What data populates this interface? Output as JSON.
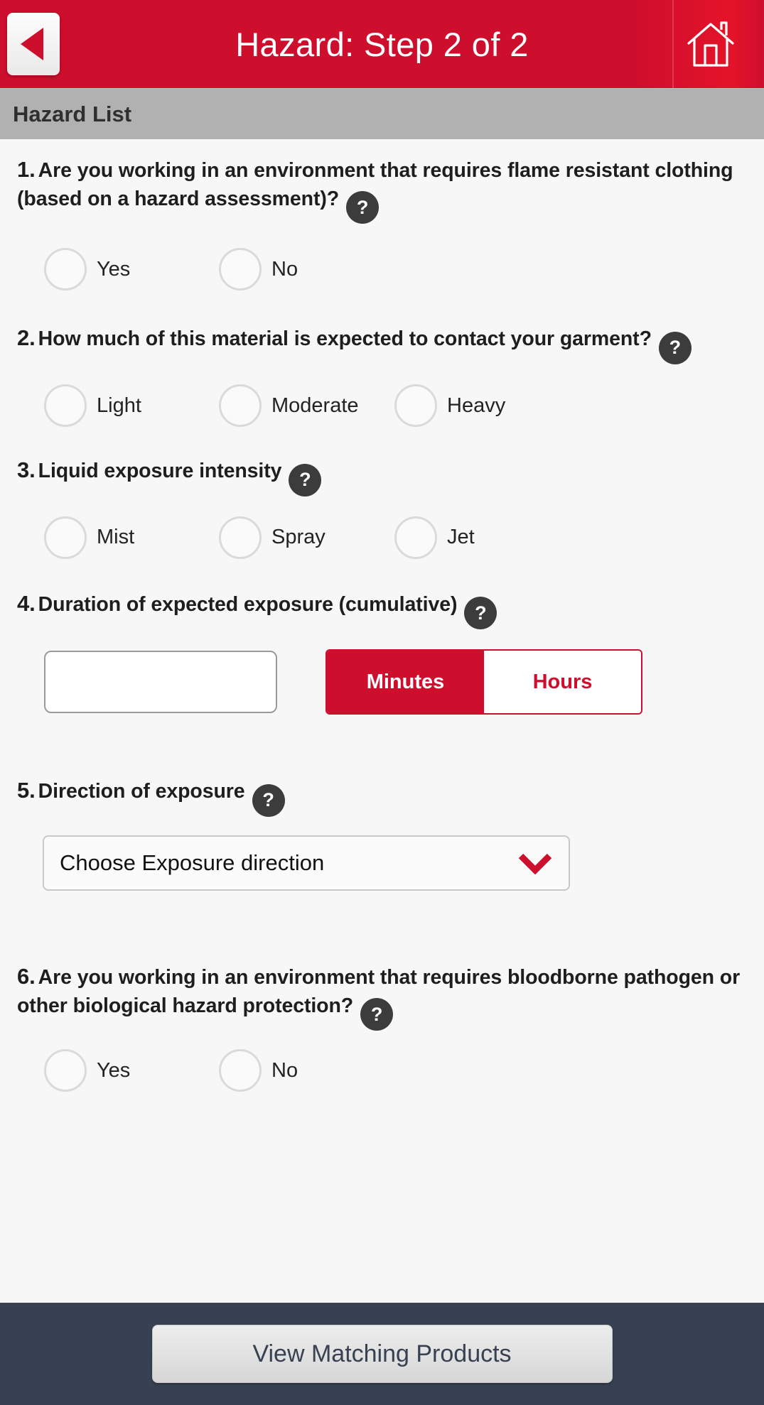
{
  "header": {
    "title": "Hazard: Step 2 of 2",
    "back_icon": "back-triangle-icon",
    "home_icon": "home-icon",
    "accent_color": "#CE0E2D"
  },
  "section": {
    "title": "Hazard List",
    "background_color": "#B1B1B1"
  },
  "help_glyph": "?",
  "questions": [
    {
      "number": "1.",
      "text": "Are you working in an environment that requires flame resistant clothing (based on a hazard assessment)?",
      "type": "radio",
      "options": [
        "Yes",
        "No"
      ]
    },
    {
      "number": "2.",
      "text": "How much of this material is expected to contact your garment?",
      "type": "radio",
      "options": [
        "Light",
        "Moderate",
        "Heavy"
      ]
    },
    {
      "number": "3.",
      "text": "Liquid exposure intensity",
      "type": "radio",
      "options": [
        "Mist",
        "Spray",
        "Jet"
      ]
    },
    {
      "number": "4.",
      "text": "Duration of expected exposure (cumulative)",
      "type": "duration",
      "input_value": "",
      "input_placeholder": "",
      "units": [
        "Minutes",
        "Hours"
      ],
      "selected_unit": "Minutes"
    },
    {
      "number": "5.",
      "text": "Direction of exposure",
      "type": "select",
      "selected_value": "Choose Exposure direction",
      "chevron_icon": "chevron-down-icon",
      "chevron_color": "#CE0E2D"
    },
    {
      "number": "6.",
      "text": "Are you working in an environment that requires bloodborne pathogen or other biological hazard protection?",
      "type": "radio",
      "options": [
        "Yes",
        "No"
      ]
    }
  ],
  "footer": {
    "button_label": "View Matching Products",
    "background_color": "#374151"
  }
}
